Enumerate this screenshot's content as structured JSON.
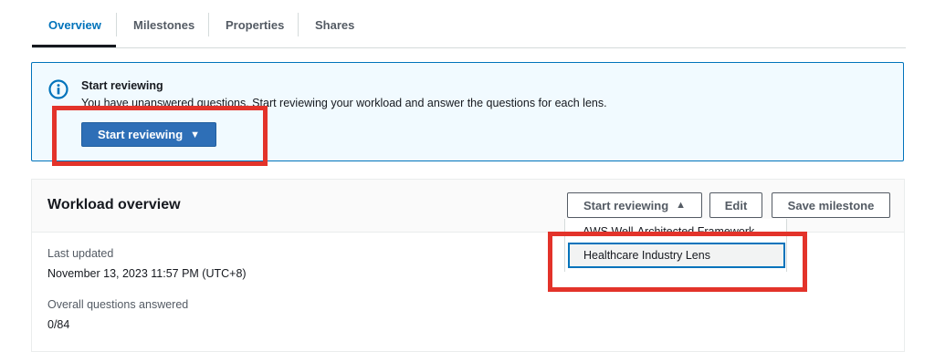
{
  "tabs": [
    {
      "label": "Overview"
    },
    {
      "label": "Milestones"
    },
    {
      "label": "Properties"
    },
    {
      "label": "Shares"
    }
  ],
  "alert": {
    "title": "Start reviewing",
    "message": "You have unanswered questions. Start reviewing your workload and answer the questions for each lens.",
    "button_label": "Start reviewing",
    "icon": "info-icon"
  },
  "workload": {
    "title": "Workload overview",
    "buttons": {
      "start_reviewing": "Start reviewing",
      "edit": "Edit",
      "save_milestone": "Save milestone"
    },
    "dropdown_items": [
      {
        "label": "AWS Well-Architected Framework"
      },
      {
        "label": "Healthcare Industry Lens"
      }
    ],
    "fields": {
      "last_updated_label": "Last updated",
      "last_updated_value": "November 13, 2023 11:57 PM (UTC+8)",
      "questions_label": "Overall questions answered",
      "questions_value": "0/84"
    }
  },
  "colors": {
    "accent": "#0073bb",
    "primary_button": "#2e6fb7",
    "highlight": "#e3332a"
  }
}
